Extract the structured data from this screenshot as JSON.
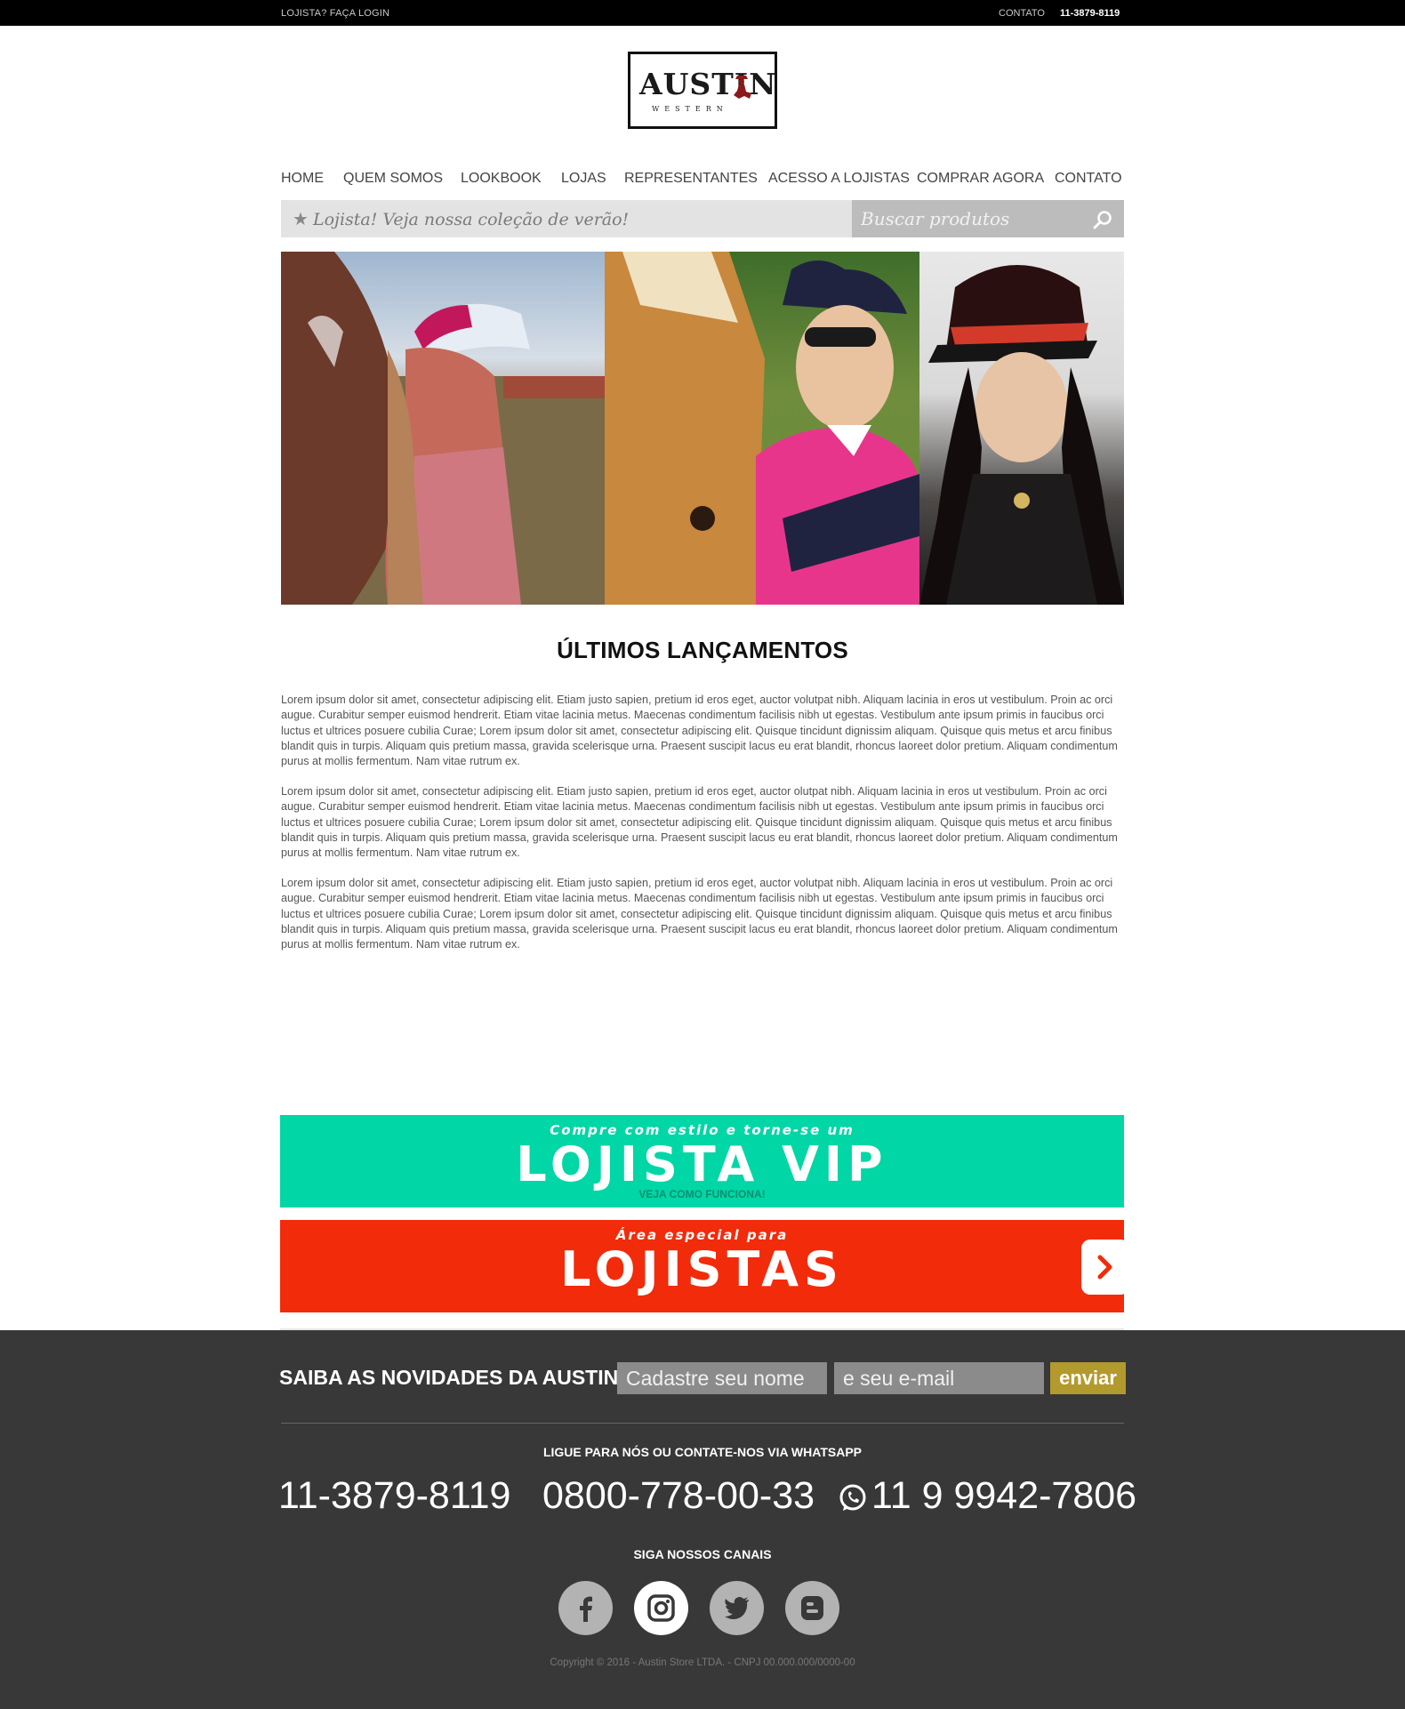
{
  "topbar": {
    "login": "LOJISTA? FAÇA LOGIN",
    "contact": "CONTATO",
    "phone": "11-3879-8119"
  },
  "logo": {
    "word": "AUSTIN",
    "sub": "WESTERN"
  },
  "nav": [
    "HOME",
    "QUEM SOMOS",
    "LOOKBOOK",
    "LOJAS",
    "REPRESENTANTES",
    "ACESSO A LOJISTAS",
    "COMPRAR AGORA",
    "CONTATO"
  ],
  "promo": {
    "star": "★",
    "text": "Lojista! Veja nossa coleção de verão!"
  },
  "search": {
    "placeholder": "Buscar produtos",
    "icon": "search-icon"
  },
  "content": {
    "title": "ÚLTIMOS LANÇAMENTOS",
    "paragraphs": [
      "Lorem ipsum dolor sit amet, consectetur adipiscing elit. Etiam justo sapien, pretium id eros eget, auctor volutpat nibh. Aliquam lacinia in eros ut vestibulum. Proin ac orci augue. Curabitur semper euismod hendrerit. Etiam vitae lacinia metus. Maecenas condimentum facilisis nibh ut egestas. Vestibulum ante ipsum primis in faucibus orci luctus et ultrices posuere cubilia Curae; Lorem ipsum dolor sit amet, consectetur adipiscing elit. Quisque tincidunt dignissim aliquam. Quisque quis metus et arcu finibus blandit quis in turpis. Aliquam quis pretium massa, gravida scelerisque urna. Praesent suscipit lacus eu erat blandit, rhoncus laoreet dolor pretium. Aliquam condimentum purus at mollis fermentum. Nam vitae rutrum ex.",
      "Lorem ipsum dolor sit amet, consectetur adipiscing elit. Etiam justo sapien, pretium id eros eget, auctor olutpat nibh. Aliquam lacinia in eros ut vestibulum. Proin ac orci augue. Curabitur semper euismod hendrerit. Etiam vitae lacinia metus. Maecenas condimentum facilisis nibh ut egestas. Vestibulum ante ipsum primis in faucibus orci luctus et ultrices posuere cubilia Curae; Lorem ipsum dolor sit amet, consectetur adipiscing elit. Quisque tincidunt dignissim aliquam. Quisque quis metus et arcu finibus blandit quis in turpis. Aliquam quis pretium massa, gravida scelerisque urna. Praesent suscipit lacus eu erat blandit, rhoncus laoreet dolor pretium. Aliquam condimentum purus at mollis fermentum. Nam vitae rutrum ex.",
      "Lorem ipsum dolor sit amet, consectetur adipiscing elit. Etiam justo sapien, pretium id eros eget, auctor volutpat nibh. Aliquam lacinia in eros ut vestibulum. Proin ac orci augue. Curabitur semper euismod hendrerit. Etiam vitae lacinia metus. Maecenas condimentum facilisis nibh ut egestas. Vestibulum ante ipsum primis in faucibus orci luctus et ultrices posuere cubilia Curae; Lorem ipsum dolor sit amet, consectetur adipiscing elit. Quisque tincidunt dignissim aliquam. Quisque quis metus et arcu finibus blandit quis in turpis. Aliquam quis pretium massa, gravida scelerisque urna. Praesent suscipit lacus eu erat blandit, rhoncus laoreet dolor pretium. Aliquam condimentum purus at mollis fermentum. Nam vitae rutrum ex."
    ]
  },
  "banners": {
    "vip": {
      "kicker": "Compre com estilo e torne-se um",
      "title": "LOJISTA VIP",
      "cta": "VEJA COMO FUNCIONA!",
      "color": "#00d6a6"
    },
    "lojistas": {
      "kicker": "Área especial para",
      "title": "LOJISTAS",
      "arrow_icon": "chevron-right-icon",
      "color": "#f22b0b"
    }
  },
  "footer": {
    "newsletter_label": "SAIBA AS NOVIDADES DA AUSTIN:",
    "name_placeholder": "Cadastre seu nome",
    "email_placeholder": "e seu e-mail",
    "send_label": "enviar",
    "send_color": "#b39a2e",
    "call_title": "LIGUE PARA NÓS OU CONTATE-NOS VIA WHATSAPP",
    "phones": [
      "11-3879-8119",
      "0800-778-00-33",
      "11 9 9942-7806"
    ],
    "whatsapp_icon": "whatsapp-icon",
    "social_title": "SIGA NOSSOS CANAIS",
    "social": [
      "facebook-icon",
      "instagram-icon",
      "twitter-icon",
      "blogger-icon"
    ],
    "copyright": "Copyright © 2016 - Austin Store LTDA. - CNPJ 00.000.000/0000-00"
  }
}
